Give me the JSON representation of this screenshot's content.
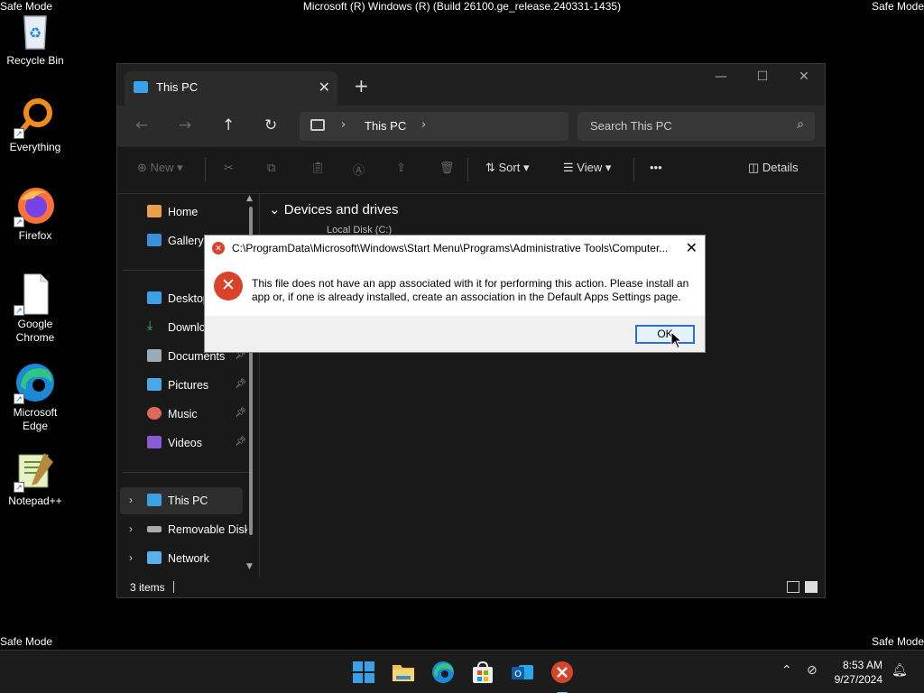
{
  "safe_mode_label": "Safe Mode",
  "build_text": "Microsoft (R) Windows (R) (Build 26100.ge_release.240331-1435)",
  "desktop_icons": [
    {
      "label": "Recycle Bin"
    },
    {
      "label": "Everything"
    },
    {
      "label": "Firefox"
    },
    {
      "label": "Google Chrome"
    },
    {
      "label": "Microsoft Edge"
    },
    {
      "label": "Notepad++"
    }
  ],
  "explorer": {
    "tab_title": "This PC",
    "address": "This PC",
    "search_placeholder": "Search This PC",
    "commands": {
      "new": "New",
      "sort": "Sort",
      "view": "View",
      "more": "•••",
      "details": "Details"
    },
    "sidebar": {
      "quick": [
        "Home",
        "Gallery"
      ],
      "pinned": [
        "Desktop",
        "Downloads",
        "Documents",
        "Pictures",
        "Music",
        "Videos"
      ],
      "tree": [
        "This PC",
        "Removable Disk",
        "Network"
      ]
    },
    "group_title": "Devices and drives",
    "drive_partial": "Local Disk (C:)",
    "status_count": "3 items"
  },
  "dialog": {
    "title": "C:\\ProgramData\\Microsoft\\Windows\\Start Menu\\Programs\\Administrative Tools\\Computer...",
    "message": "This file does not have an app associated with it for performing this action. Please install an app or, if one is already installed, create an association in the Default Apps Settings page.",
    "ok_label": "OK"
  },
  "taskbar": {
    "apps": [
      "start-icon",
      "file-explorer-icon",
      "edge-icon",
      "store-icon",
      "outlook-icon",
      "error-app-icon"
    ],
    "time": "8:53 AM",
    "date": "9/27/2024"
  },
  "colors": {
    "accent": "#60cdff",
    "error": "#d8432b",
    "window_bg": "#191919"
  }
}
